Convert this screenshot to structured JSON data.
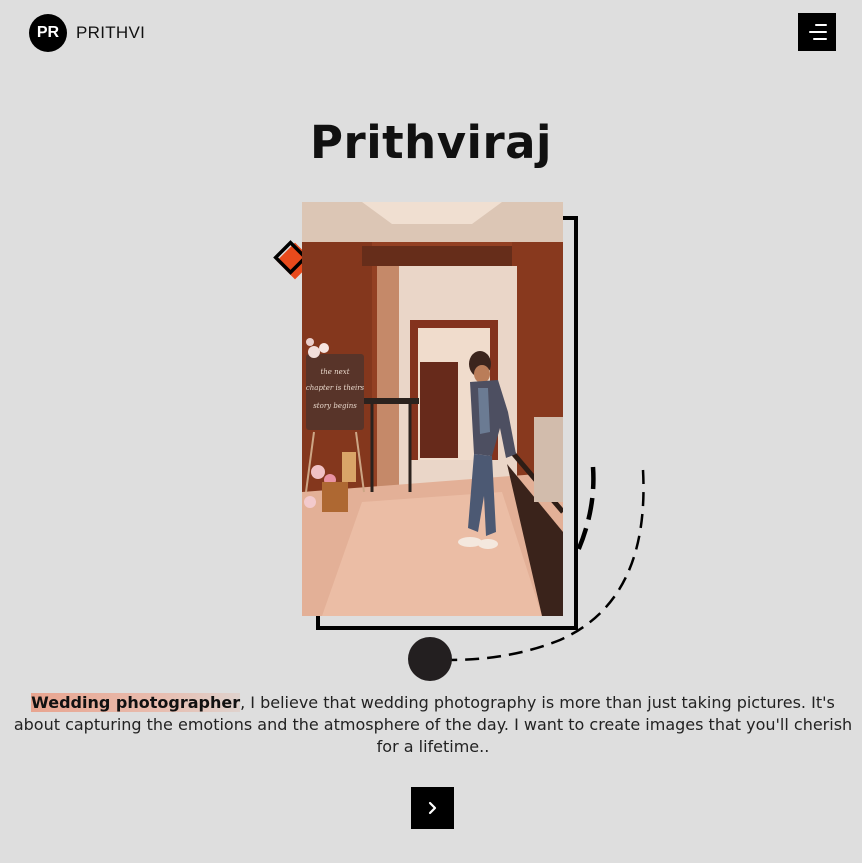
{
  "header": {
    "logo_initials": "PR",
    "logo_name": "PRITHVI",
    "menu_icon": "hamburger-menu-icon"
  },
  "hero": {
    "title": "Prithviraj",
    "photo_description_icon": "portrait-photo",
    "sign_text": "the next chapter is theirs story begins"
  },
  "intro": {
    "highlight": "Wedding photographer",
    "text": ", I believe that wedding photography is more than just taking pictures. It's about capturing the emotions and the atmosphere of the day. I want to create images that you'll cherish for a lifetime.."
  },
  "actions": {
    "next_icon": "chevron-right-icon"
  },
  "colors": {
    "background": "#dedede",
    "accent": "#e84a1c",
    "dark": "#000000",
    "highlight": "#e8a48f"
  }
}
